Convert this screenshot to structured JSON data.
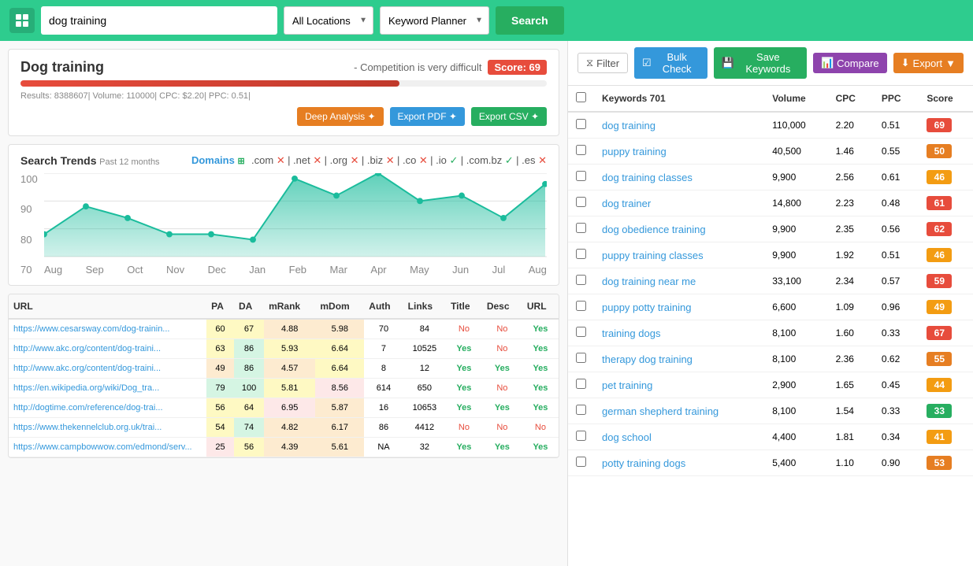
{
  "header": {
    "search_value": "dog training",
    "locations_label": "All Locations",
    "tool_label": "Keyword Planner",
    "search_button": "Search"
  },
  "score_card": {
    "title": "Dog training",
    "competition_text": "- Competition is very difficult",
    "score_label": "Score: 69",
    "meta": "Results: 8388607| Volume: 110000| CPC: $2.20| PPC: 0.51|",
    "btn_deep": "Deep Analysis ✦",
    "btn_pdf": "Export PDF ✦",
    "btn_csv": "Export CSV ✦",
    "fill_percent": 72
  },
  "trends": {
    "title": "Search Trends",
    "subtitle": "Past 12 months",
    "domains_label": "Domains",
    "domains": [
      ".com",
      ".net",
      ".org",
      ".biz",
      ".co",
      ".io",
      ".com.bz",
      ".es"
    ],
    "domain_status": [
      "x",
      "x",
      "x",
      "x",
      "x",
      "check",
      "check",
      "x"
    ],
    "y_labels": [
      "100",
      "90",
      "80",
      "70"
    ],
    "x_labels": [
      "Aug",
      "Sep",
      "Oct",
      "Nov",
      "Dec",
      "Jan",
      "Feb",
      "Mar",
      "Apr",
      "May",
      "Jun",
      "Jul",
      "Aug"
    ],
    "chart_data": [
      78,
      88,
      84,
      80,
      78,
      76,
      98,
      92,
      100,
      90,
      92,
      84,
      96
    ]
  },
  "url_table": {
    "headers": [
      "URL",
      "PA",
      "DA",
      "mRank",
      "mDom",
      "Auth",
      "Links",
      "Title",
      "Desc",
      "URL"
    ],
    "rows": [
      {
        "url": "https://www.cesarsway.com/dog-trainin...",
        "pa": 60,
        "da": 67,
        "mrank": "4.88",
        "mdom": "5.98",
        "auth": 70,
        "links": 84,
        "title": "No",
        "desc": "No",
        "url2": "Yes",
        "pa_class": "cell-yellow",
        "da_class": "cell-yellow",
        "mrank_class": "cell-orange",
        "mdom_class": "cell-orange"
      },
      {
        "url": "http://www.akc.org/content/dog-traini...",
        "pa": 63,
        "da": 86,
        "mrank": "5.93",
        "mdom": "6.64",
        "auth": 7,
        "links": 10525,
        "title": "Yes",
        "desc": "No",
        "url2": "Yes",
        "pa_class": "cell-yellow",
        "da_class": "cell-green",
        "mrank_class": "cell-yellow",
        "mdom_class": "cell-yellow"
      },
      {
        "url": "http://www.akc.org/content/dog-traini...",
        "pa": 49,
        "da": 86,
        "mrank": "4.57",
        "mdom": "6.64",
        "auth": 8,
        "links": 12,
        "title": "Yes",
        "desc": "Yes",
        "url2": "Yes",
        "pa_class": "cell-orange",
        "da_class": "cell-green",
        "mrank_class": "cell-orange",
        "mdom_class": "cell-yellow"
      },
      {
        "url": "https://en.wikipedia.org/wiki/Dog_tra...",
        "pa": 79,
        "da": 100,
        "mrank": "5.81",
        "mdom": "8.56",
        "auth": 614,
        "links": 650,
        "title": "Yes",
        "desc": "No",
        "url2": "Yes",
        "pa_class": "cell-green",
        "da_class": "cell-green",
        "mrank_class": "cell-yellow",
        "mdom_class": "cell-red"
      },
      {
        "url": "http://dogtime.com/reference/dog-trai...",
        "pa": 56,
        "da": 64,
        "mrank": "6.95",
        "mdom": "5.87",
        "auth": 16,
        "links": 10653,
        "title": "Yes",
        "desc": "Yes",
        "url2": "Yes",
        "pa_class": "cell-yellow",
        "da_class": "cell-yellow",
        "mrank_class": "cell-red",
        "mdom_class": "cell-orange"
      },
      {
        "url": "https://www.thekennelclub.org.uk/trai...",
        "pa": 54,
        "da": 74,
        "mrank": "4.82",
        "mdom": "6.17",
        "auth": 86,
        "links": 4412,
        "title": "No",
        "desc": "No",
        "url2": "No",
        "pa_class": "cell-yellow",
        "da_class": "cell-green",
        "mrank_class": "cell-orange",
        "mdom_class": "cell-orange"
      },
      {
        "url": "https://www.campbowwow.com/edmond/serv...",
        "pa": 25,
        "da": 56,
        "mrank": "4.39",
        "mdom": "5.61",
        "auth": "NA",
        "links": 32,
        "title": "Yes",
        "desc": "Yes",
        "url2": "Yes",
        "pa_class": "cell-red",
        "da_class": "cell-yellow",
        "mrank_class": "cell-orange",
        "mdom_class": "cell-orange"
      }
    ]
  },
  "right_toolbar": {
    "filter_label": "Filter",
    "bulk_check_label": "Bulk Check",
    "save_keywords_label": "Save Keywords",
    "compare_label": "Compare",
    "export_label": "Export"
  },
  "keywords_table": {
    "header_keywords": "Keywords 701",
    "header_volume": "Volume",
    "header_cpc": "CPC",
    "header_ppc": "PPC",
    "header_score": "Score",
    "rows": [
      {
        "keyword": "dog training",
        "volume": 110000,
        "cpc": "2.20",
        "ppc": "0.51",
        "score": 69,
        "score_class": "score-red"
      },
      {
        "keyword": "puppy training",
        "volume": 40500,
        "cpc": "1.46",
        "ppc": "0.55",
        "score": 50,
        "score_class": "score-orange"
      },
      {
        "keyword": "dog training classes",
        "volume": 9900,
        "cpc": "2.56",
        "ppc": "0.61",
        "score": 46,
        "score_class": "score-yellow"
      },
      {
        "keyword": "dog trainer",
        "volume": 14800,
        "cpc": "2.23",
        "ppc": "0.48",
        "score": 61,
        "score_class": "score-red"
      },
      {
        "keyword": "dog obedience training",
        "volume": 9900,
        "cpc": "2.35",
        "ppc": "0.56",
        "score": 62,
        "score_class": "score-red"
      },
      {
        "keyword": "puppy training classes",
        "volume": 9900,
        "cpc": "1.92",
        "ppc": "0.51",
        "score": 46,
        "score_class": "score-yellow"
      },
      {
        "keyword": "dog training near me",
        "volume": 33100,
        "cpc": "2.34",
        "ppc": "0.57",
        "score": 59,
        "score_class": "score-red"
      },
      {
        "keyword": "puppy potty training",
        "volume": 6600,
        "cpc": "1.09",
        "ppc": "0.96",
        "score": 49,
        "score_class": "score-yellow"
      },
      {
        "keyword": "training dogs",
        "volume": 8100,
        "cpc": "1.60",
        "ppc": "0.33",
        "score": 67,
        "score_class": "score-red"
      },
      {
        "keyword": "therapy dog training",
        "volume": 8100,
        "cpc": "2.36",
        "ppc": "0.62",
        "score": 55,
        "score_class": "score-orange"
      },
      {
        "keyword": "pet training",
        "volume": 2900,
        "cpc": "1.65",
        "ppc": "0.45",
        "score": 44,
        "score_class": "score-yellow"
      },
      {
        "keyword": "german shepherd training",
        "volume": 8100,
        "cpc": "1.54",
        "ppc": "0.33",
        "score": 33,
        "score_class": "score-green"
      },
      {
        "keyword": "dog school",
        "volume": 4400,
        "cpc": "1.81",
        "ppc": "0.34",
        "score": 41,
        "score_class": "score-yellow"
      },
      {
        "keyword": "potty training dogs",
        "volume": 5400,
        "cpc": "1.10",
        "ppc": "0.90",
        "score": 53,
        "score_class": "score-orange"
      }
    ]
  }
}
